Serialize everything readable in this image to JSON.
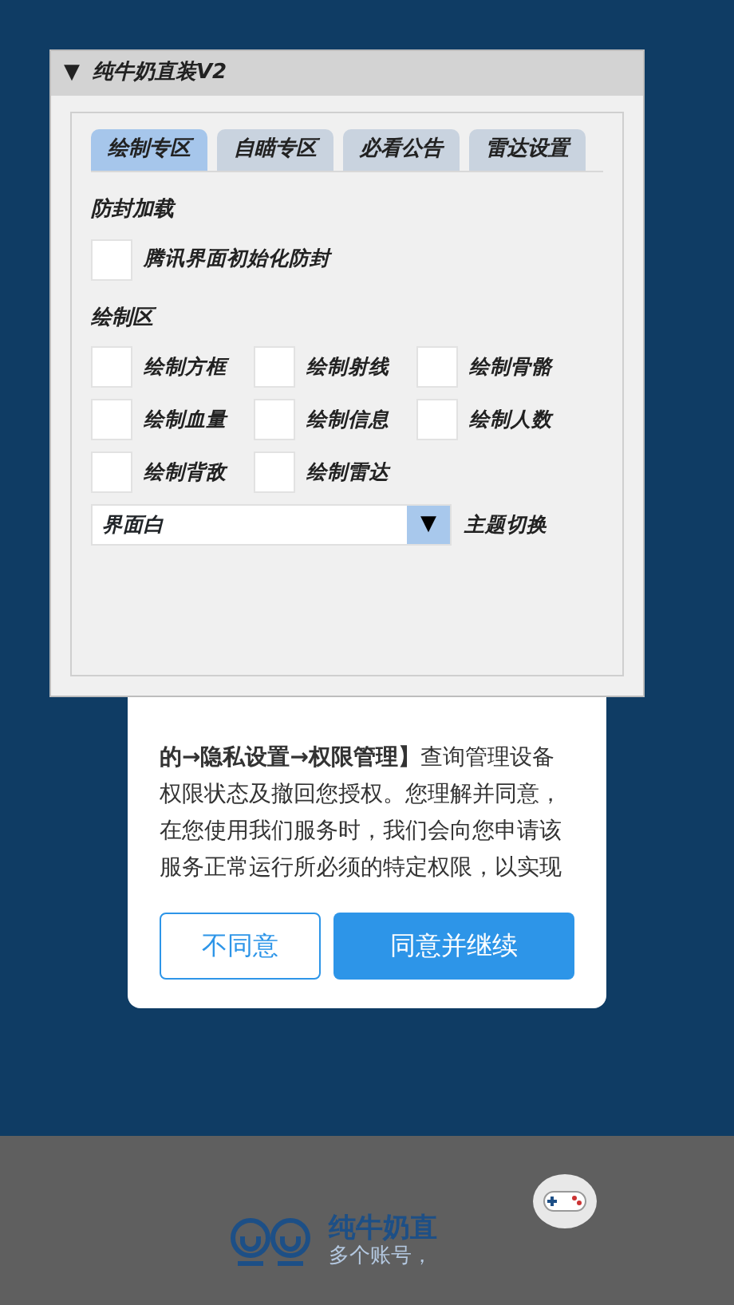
{
  "window": {
    "title": "纯牛奶直装V2",
    "collapse_glyph": "▼",
    "tabs": [
      {
        "label": "绘制专区",
        "selected": true
      },
      {
        "label": "自瞄专区",
        "selected": false
      },
      {
        "label": "必看公告",
        "selected": false
      },
      {
        "label": "雷达设置",
        "selected": false
      }
    ],
    "sections": [
      {
        "title": "防封加载",
        "checkboxes": [
          {
            "label": "腾讯界面初始化防封",
            "checked": false
          }
        ]
      },
      {
        "title": "绘制区",
        "checkboxes": [
          {
            "label": "绘制方框",
            "checked": false
          },
          {
            "label": "绘制射线",
            "checked": false
          },
          {
            "label": "绘制骨骼",
            "checked": false
          },
          {
            "label": "绘制血量",
            "checked": false
          },
          {
            "label": "绘制信息",
            "checked": false
          },
          {
            "label": "绘制人数",
            "checked": false
          },
          {
            "label": "绘制背敌",
            "checked": false
          },
          {
            "label": "绘制雷达",
            "checked": false
          }
        ]
      }
    ],
    "theme_select": {
      "value": "界面白",
      "arrow": "▼",
      "label": "主题切换"
    }
  },
  "dialog": {
    "text": "**的→隐私设置→权限管理】**查询管理设备权限状态及撤回您授权。您理解并同意，在您使用我们服务时，我们会向您申请该服务正常运行所必须的特定权限，以实现",
    "buttons": [
      {
        "label": "不同意",
        "kind": "outline"
      },
      {
        "label": "同意并继续",
        "kind": "primary"
      }
    ]
  },
  "footer": {
    "title": "纯牛奶直",
    "subtitle": "多个账号，"
  }
}
